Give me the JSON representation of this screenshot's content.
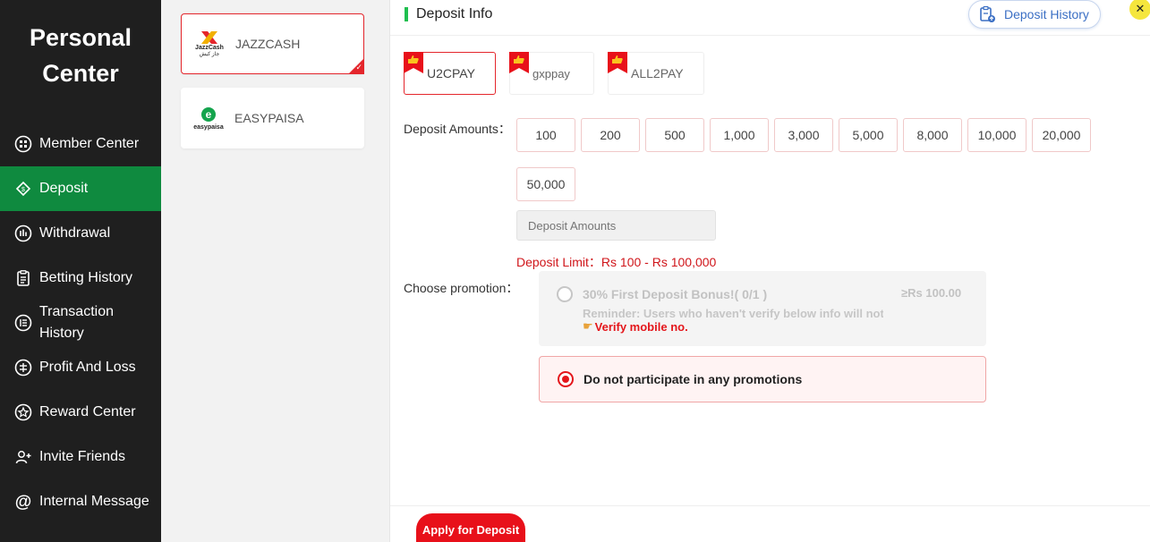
{
  "sidebar": {
    "title_line1": "Personal",
    "title_line2": "Center",
    "items": [
      {
        "label": "Member Center",
        "icon": "member-icon"
      },
      {
        "label": "Deposit",
        "icon": "deposit-icon",
        "active": true
      },
      {
        "label": "Withdrawal",
        "icon": "withdrawal-icon"
      },
      {
        "label": "Betting History",
        "icon": "betting-history-icon"
      },
      {
        "label_line1": "Transaction",
        "label_line2": "History",
        "icon": "transaction-history-icon"
      },
      {
        "label": "Profit And Loss",
        "icon": "profit-loss-icon"
      },
      {
        "label": "Reward Center",
        "icon": "reward-icon"
      },
      {
        "label": "Invite Friends",
        "icon": "invite-icon"
      },
      {
        "label": "Internal Message",
        "icon": "at-icon"
      }
    ]
  },
  "methods": [
    {
      "label": "JAZZCASH",
      "logo_text_1": "JazzCash",
      "logo_text_2": "جاز کیش",
      "selected": true
    },
    {
      "label": "EASYPAISA",
      "logo_text_1": "easypaisa",
      "selected": false
    }
  ],
  "header": {
    "title": "Deposit Info",
    "history_label": "Deposit History",
    "close_symbol": "✕"
  },
  "channels": [
    {
      "label": "U2CPAY",
      "selected": true
    },
    {
      "label": "gxppay",
      "selected": false
    },
    {
      "label": "ALL2PAY",
      "selected": false
    }
  ],
  "amounts": {
    "label": "Deposit Amounts：",
    "options": [
      "100",
      "200",
      "500",
      "1,000",
      "3,000",
      "5,000",
      "8,000",
      "10,000",
      "20,000",
      "50,000"
    ],
    "input_placeholder": "Deposit Amounts",
    "limit_text": "Deposit Limit：Rs  100  - Rs  100,000"
  },
  "promotion": {
    "label": "Choose promotion：",
    "option_title": "30% First Deposit Bonus!( 0/1 )",
    "option_amount": "≥Rs   100.00",
    "option_reminder": "Reminder: Users who haven't verify below info will not",
    "option_verify": "Verify mobile no.",
    "no_promo_text": "Do not participate in any promotions"
  },
  "footer": {
    "apply_label": "Apply for Deposit"
  },
  "colors": {
    "sidebar_bg": "#1f1f1f",
    "active_green": "#0f8a3f",
    "accent_red": "#e4262c",
    "header_bar_green": "#1fbf4f",
    "history_blue": "#3b6fc4",
    "close_yellow": "#f5e63d"
  }
}
